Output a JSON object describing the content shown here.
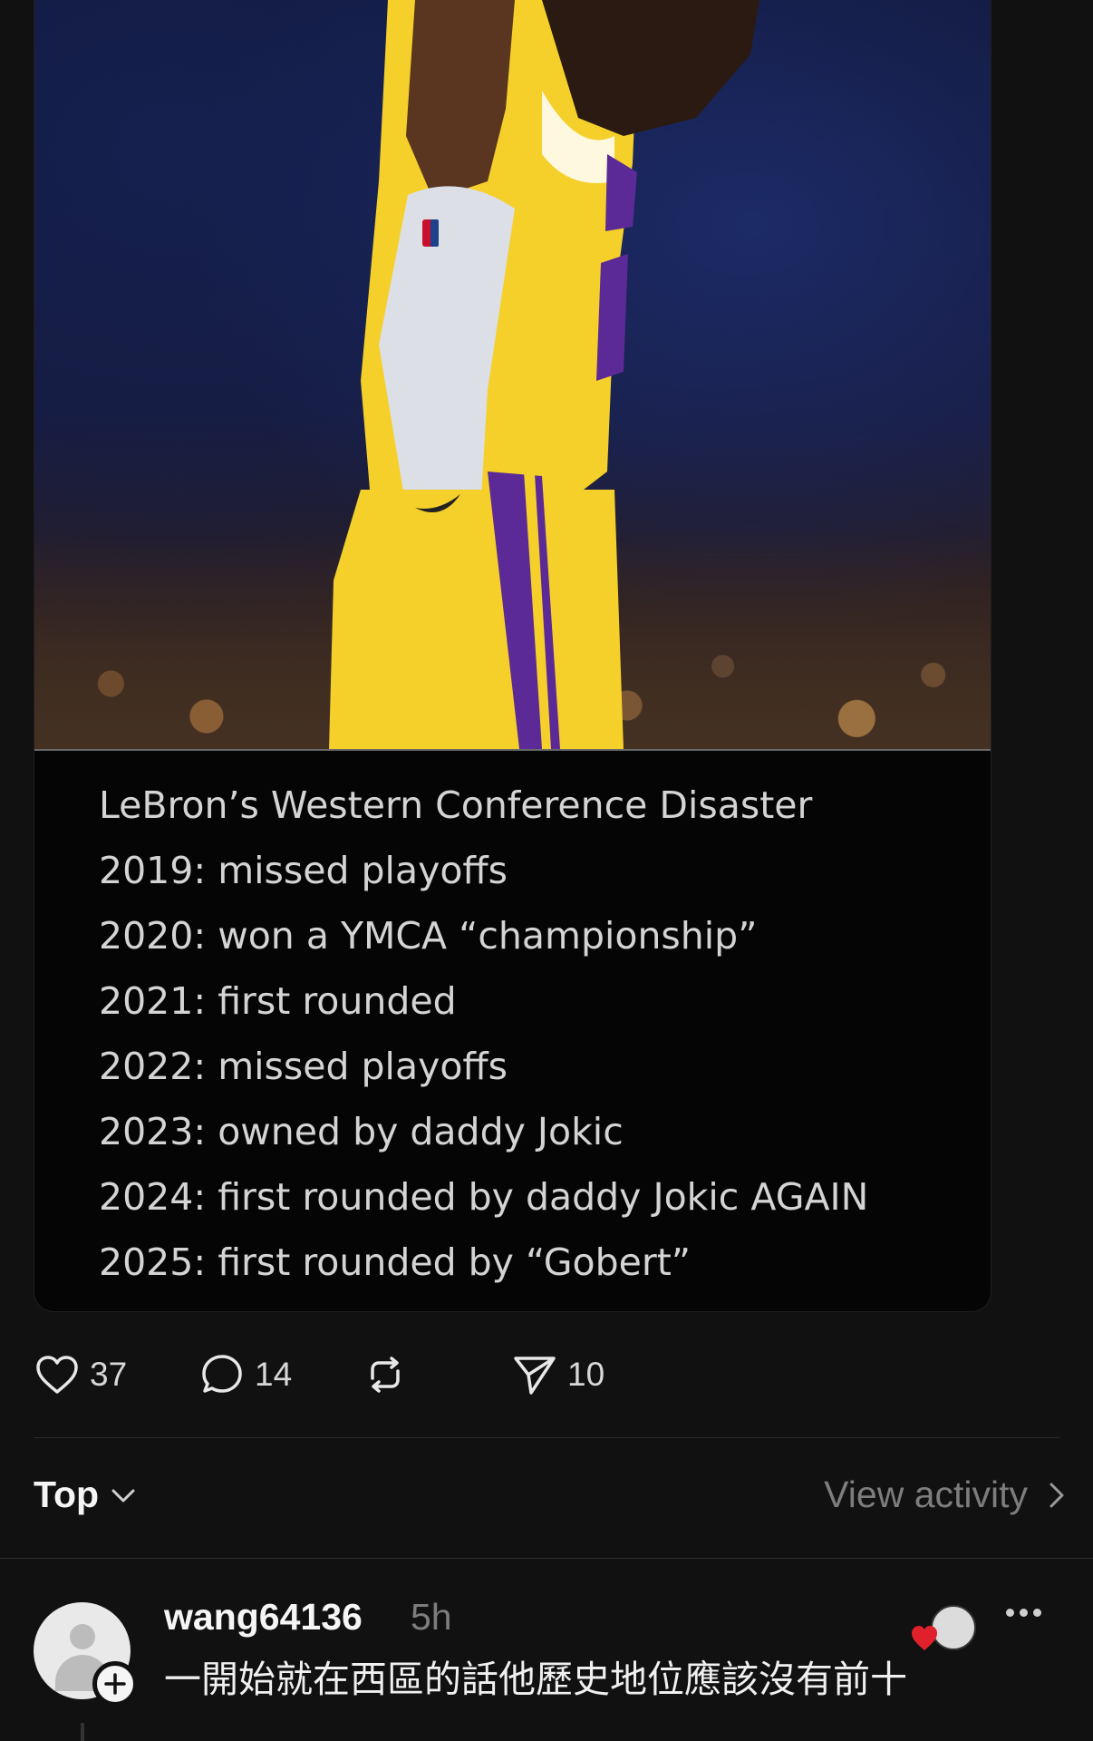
{
  "post": {
    "image_alt": "player in yellow jersey looking down",
    "overlay_lines": [
      "LeBron’s Western Conference Disaster",
      "2019: missed playoffs",
      "2020: won a YMCA “championship”",
      "2021: first rounded",
      "2022: missed playoffs",
      "2023: owned by daddy Jokic",
      "2024: first rounded by daddy Jokic AGAIN",
      "2025: first rounded by “Gobert”"
    ]
  },
  "actions": {
    "like_count": "37",
    "reply_count": "14",
    "share_count": "10",
    "icons": [
      "heart-icon",
      "comment-icon",
      "repost-icon",
      "send-icon"
    ]
  },
  "replies_header": {
    "sort_label": "Top",
    "view_activity_label": "View activity"
  },
  "comment": {
    "username": "wang64136",
    "timestamp": "5h",
    "text": "一開始就在西區的話他歷史地位應該沒有前十"
  },
  "colors": {
    "background": "#111111",
    "card": "#050505",
    "jersey_yellow": "#f5d02a",
    "jersey_purple": "#5b2a96",
    "heart_red": "#e0202a",
    "muted_text": "#7d7d7d"
  }
}
